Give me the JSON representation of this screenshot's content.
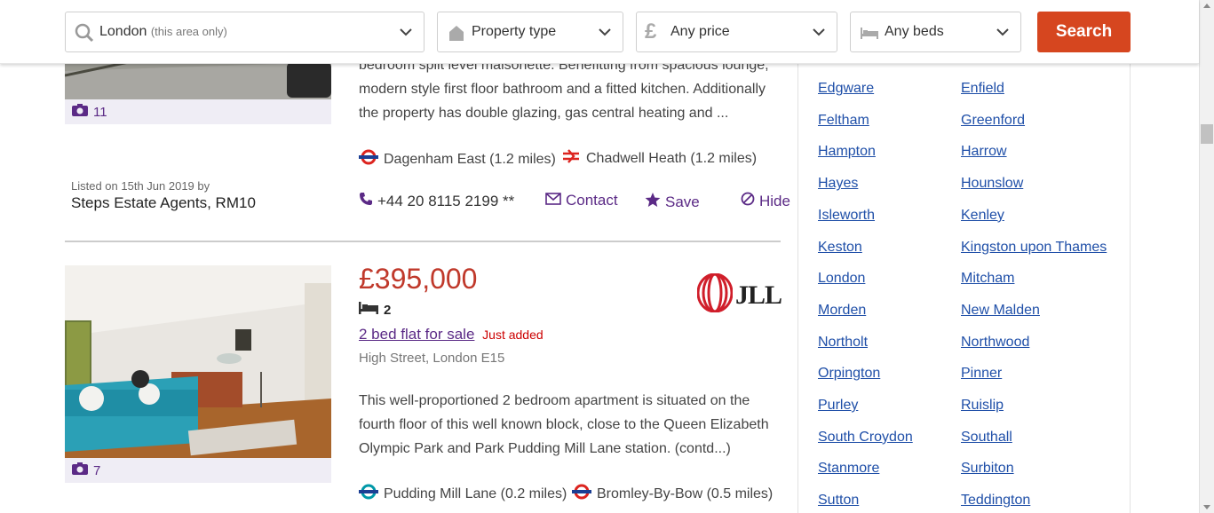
{
  "search": {
    "location_value": "London",
    "location_hint": "(this area only)",
    "property_type": "Property type",
    "price": "Any price",
    "beds": "Any beds",
    "button_label": "Search"
  },
  "listing1": {
    "desc_line1": "bedroom split level maisonette. Benefitting from spacious lounge,",
    "desc_line2": "modern style first floor bathroom and a fitted kitchen. Additionally",
    "desc_line3": "the property has double glazing, gas central heating and ...",
    "photo_count": "11",
    "station1": "Dagenham East (1.2 miles)",
    "station2": "Chadwell Heath (1.2 miles)",
    "listed_on": "Listed on 15th Jun 2019 by",
    "agent": "Steps Estate Agents, RM10",
    "phone": "+44 20 8115 2199 **",
    "contact_label": "Contact",
    "save_label": "Save",
    "hide_label": "Hide"
  },
  "listing2": {
    "price": "£395,000",
    "beds": "2",
    "title": "2 bed flat for sale",
    "badge": "Just added",
    "address": "High Street, London E15",
    "agent_logo": "JLL",
    "desc_line1": "This well-proportioned 2 bedroom apartment is situated on the",
    "desc_line2": "fourth floor of this well known block, close to the Queen Elizabeth",
    "desc_line3": "Olympic Park and Park Pudding Mill Lane station. (contd...)",
    "photo_count": "7",
    "station1": "Pudding Mill Lane (0.2 miles)",
    "station2": "Bromley-By-Bow (0.5 miles)"
  },
  "sidebar": {
    "left": [
      "Edgware",
      "Feltham",
      "Hampton",
      "Hayes",
      "Isleworth",
      "Keston",
      "London",
      "Morden",
      "Northolt",
      "Orpington",
      "Purley",
      "South Croydon",
      "Stanmore",
      "Sutton"
    ],
    "right": [
      "Enfield",
      "Greenford",
      "Harrow",
      "Hounslow",
      "Kenley",
      "Kingston upon Thames",
      "Mitcham",
      "New Malden",
      "Northwood",
      "Pinner",
      "Ruislip",
      "Southall",
      "Surbiton",
      "Teddington"
    ]
  },
  "colors": {
    "accent": "#5b2a86",
    "price": "#c0392b",
    "search_button": "#d6461f",
    "link": "#1f4fa8"
  },
  "icons": {
    "location": "search-icon",
    "property": "house-icon",
    "price": "pound-icon",
    "beds": "bed-icon",
    "photo": "camera-icon",
    "underground": "tube-roundel-icon",
    "rail": "national-rail-icon",
    "phone": "phone-icon",
    "contact": "envelope-icon",
    "save": "star-icon",
    "hide": "hide-icon"
  }
}
